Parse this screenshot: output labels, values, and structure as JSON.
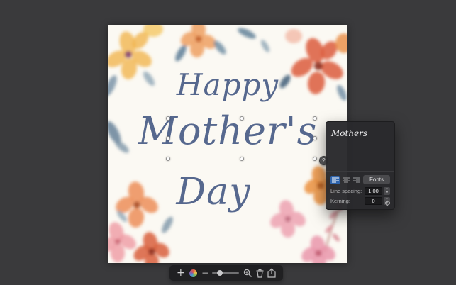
{
  "app": {
    "background_color": "#3a3a3c"
  },
  "canvas": {
    "greeting_line1": "Happy",
    "greeting_line2": "Mother's",
    "greeting_line3": "Day",
    "text_color": "#56688e",
    "paper_color": "#fbf9f3"
  },
  "help_badge": {
    "glyph": "?"
  },
  "text_panel": {
    "preview_text": "Mothers",
    "fonts_button_label": "Fonts",
    "line_spacing_label": "Line spacing:",
    "line_spacing_value": "1.00",
    "kerning_label": "Kerning:",
    "kerning_value": "0",
    "alignment_selected": "left",
    "stepper_up_glyph": "▲",
    "stepper_down_glyph": "▼",
    "gear_glyph": "⚙",
    "accent_color": "#2e63ab",
    "panel_color": "#29292c"
  },
  "toolbar": {
    "add_glyph": "+",
    "zoom_out_glyph": "−",
    "icons": [
      "add",
      "color-wheel",
      "zoom-out",
      "zoom-slider",
      "zoom-in-magnifier",
      "trash",
      "share"
    ]
  }
}
